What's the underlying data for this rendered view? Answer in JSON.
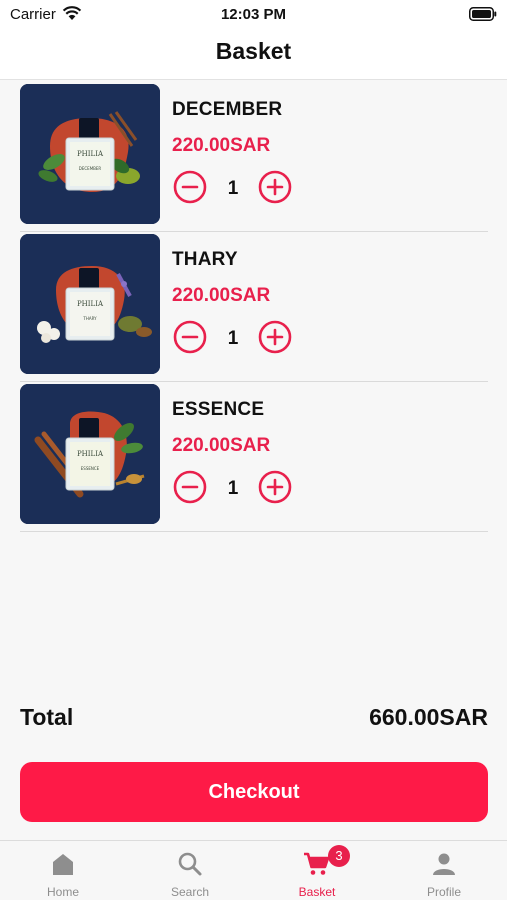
{
  "status_bar": {
    "carrier": "Carrier",
    "time": "12:03 PM"
  },
  "header": {
    "title": "Basket"
  },
  "basket": {
    "items": [
      {
        "name": "DECEMBER",
        "price": "220.00SAR",
        "quantity": "1",
        "brand": "PHILIA",
        "bottle_label": "DECEMBER"
      },
      {
        "name": "THARY",
        "price": "220.00SAR",
        "quantity": "1",
        "brand": "PHILIA",
        "bottle_label": "THARY"
      },
      {
        "name": "ESSENCE",
        "price": "220.00SAR",
        "quantity": "1",
        "brand": "PHILIA",
        "bottle_label": "ESSENCE"
      }
    ]
  },
  "summary": {
    "total_label": "Total",
    "total_value": "660.00SAR"
  },
  "checkout": {
    "label": "Checkout"
  },
  "tab_bar": {
    "tabs": [
      {
        "label": "Home",
        "icon": "home-icon"
      },
      {
        "label": "Search",
        "icon": "search-icon"
      },
      {
        "label": "Basket",
        "icon": "cart-icon",
        "badge": "3",
        "active": true
      },
      {
        "label": "Profile",
        "icon": "person-icon"
      }
    ]
  },
  "colors": {
    "accent": "#e8204c",
    "checkout_button": "#fe1a47",
    "thumbnail_bg": "#1b2e57",
    "inactive_tab": "#8e8e8e"
  }
}
